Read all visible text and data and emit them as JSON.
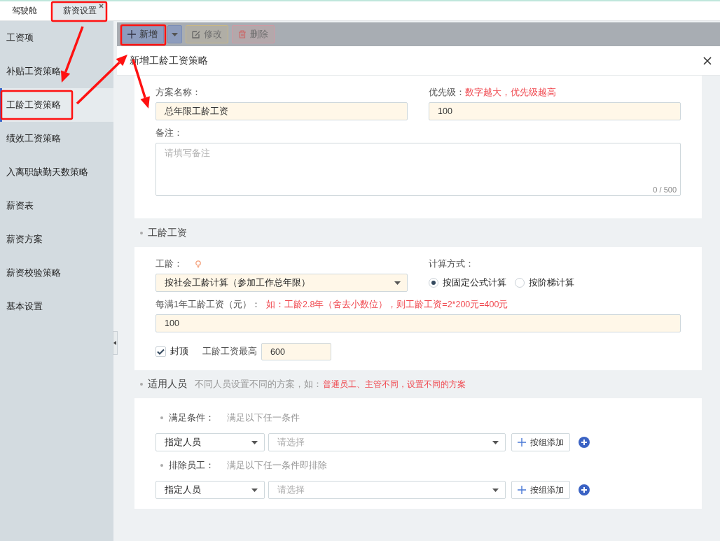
{
  "tabs": [
    {
      "label": "驾驶舱",
      "selected": false,
      "closable": false
    },
    {
      "label": "薪资设置",
      "selected": true,
      "closable": true
    }
  ],
  "sidebar": {
    "items": [
      {
        "label": "工资项",
        "selected": false
      },
      {
        "label": "补贴工资策略",
        "selected": false
      },
      {
        "label": "工龄工资策略",
        "selected": true
      },
      {
        "label": "绩效工资策略",
        "selected": false
      },
      {
        "label": "入离职缺勤天数策略",
        "selected": false
      },
      {
        "label": "薪资表",
        "selected": false
      },
      {
        "label": "薪资方案",
        "selected": false
      },
      {
        "label": "薪资校验策略",
        "selected": false
      },
      {
        "label": "基本设置",
        "selected": false
      }
    ]
  },
  "toolbar": {
    "buttons": [
      {
        "kind": "add",
        "label": "新增",
        "disabled": false
      },
      {
        "kind": "menu"
      },
      {
        "kind": "edit",
        "label": "修改",
        "disabled": true
      },
      {
        "kind": "delete",
        "label": "删除",
        "disabled": true
      }
    ]
  },
  "dialog": {
    "title": "新增工龄工资策略",
    "basic": {
      "name_label": "方案名称：",
      "name_value": "总年限工龄工资",
      "priority_label": "优先级：",
      "priority_hint": "数字越大，优先级越高",
      "priority_value": "100",
      "note_label": "备注：",
      "note_placeholder": "请填写备注",
      "note_counter": "0 / 500"
    },
    "seniority": {
      "section_title": "工龄工资",
      "seniority_label": "工龄：",
      "seniority_value": "按社会工龄计算（参加工作总年限）",
      "method_label": "计算方式：",
      "methods": [
        {
          "label": "按固定公式计算",
          "selected": true
        },
        {
          "label": "按阶梯计算",
          "selected": false
        }
      ],
      "per_year_label": "每满1年工龄工资（元）：",
      "per_year_hint": "如：工龄2.8年（舍去小数位），则工龄工资=2*200元=400元",
      "per_year_value": "100",
      "cap": {
        "label": "封顶",
        "checked": true
      },
      "max_label": "工龄工资最高",
      "max_value": "600"
    },
    "applicable": {
      "section_title": "适用人员",
      "section_note": "不同人员设置不同的方案，如：",
      "section_hint": "普通员工、主管不同，设置不同的方案",
      "groups": [
        {
          "title": "满足条件：",
          "note": "满足以下任一条件",
          "type_value": "指定人员",
          "select_placeholder": "请选择",
          "add_label": "按组添加"
        },
        {
          "title": "排除员工：",
          "note": "满足以下任一条件即排除",
          "type_value": "指定人员",
          "select_placeholder": "请选择",
          "add_label": "按组添加"
        }
      ]
    }
  }
}
